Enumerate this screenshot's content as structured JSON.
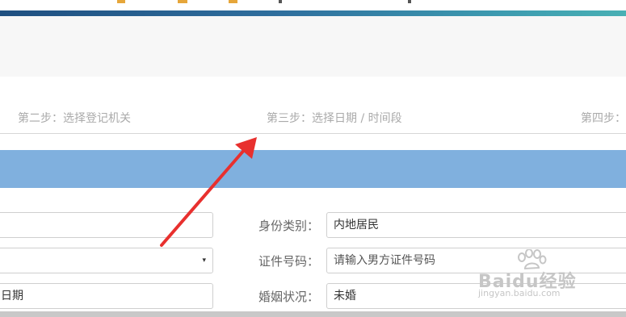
{
  "colors": {
    "accent_gradient_start": "#1f4f80",
    "accent_gradient_end": "#49b0b4",
    "blue_band": "#80b0de",
    "annotation_arrow": "#e8302e",
    "step_text": "#aaaaaa"
  },
  "steps": [
    {
      "label": "第二步：选择登记机关"
    },
    {
      "label": "第三步：选择日期 / 时间段"
    },
    {
      "label": "第四步："
    }
  ],
  "form": {
    "left": {
      "row2_caret": "▾",
      "row3_value": "日期"
    },
    "right": {
      "id_type_label": "身份类别：",
      "id_type_value": "内地居民",
      "id_number_label": "证件号码：",
      "id_number_placeholder": "请输入男方证件号码",
      "marital_label": "婚姻状况：",
      "marital_value": "未婚"
    }
  },
  "watermark": {
    "brand": "Baidu经验",
    "url": "jingyan.baidu.com"
  }
}
